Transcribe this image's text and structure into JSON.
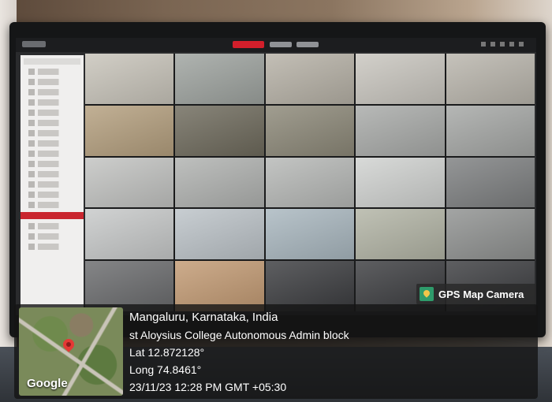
{
  "gps_badge": {
    "label": "GPS Map Camera"
  },
  "location": {
    "place": "Mangaluru, Karnataka, India",
    "address": "st Aloysius College Autonomous Admin block",
    "lat": "Lat 12.872128°",
    "long": "Long 74.8461°",
    "datetime": "23/11/23 12:28 PM GMT +05:30"
  },
  "map": {
    "attribution": "Google"
  },
  "nvr": {
    "cameras": [
      {
        "color": "#c8c4ba"
      },
      {
        "color": "#9ea39f"
      },
      {
        "color": "#b6b1a6"
      },
      {
        "color": "#c9c6bf"
      },
      {
        "color": "#b9b5ac"
      },
      {
        "color": "#b49f7e"
      },
      {
        "color": "#6e6a5c"
      },
      {
        "color": "#8c8878"
      },
      {
        "color": "#a8aaa8"
      },
      {
        "color": "#a5a7a5"
      },
      {
        "color": "#c2c3c1"
      },
      {
        "color": "#b0b2b0"
      },
      {
        "color": "#b6b8b6"
      },
      {
        "color": "#d0d2d0"
      },
      {
        "color": "#7d7f80"
      },
      {
        "color": "#c7c9c9"
      },
      {
        "color": "#bcc3c8"
      },
      {
        "color": "#a9b7bf"
      },
      {
        "color": "#b2b4a5"
      },
      {
        "color": "#8f9190"
      },
      {
        "color": "#6a6b6d"
      },
      {
        "color": "#c29a73"
      }
    ]
  }
}
